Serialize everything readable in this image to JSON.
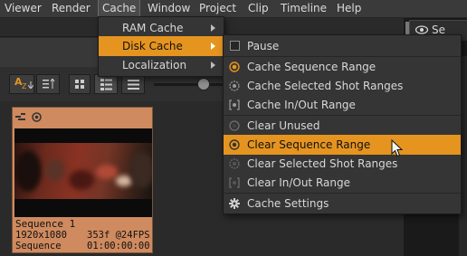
{
  "menubar": {
    "items": [
      "Viewer",
      "Render",
      "Cache",
      "Window",
      "Project",
      "Clip",
      "Timeline",
      "Help"
    ],
    "active": "Cache"
  },
  "right_tab": {
    "label": "Se",
    "icon": "eye-icon"
  },
  "cache_menu": {
    "items": [
      {
        "label": "RAM Cache",
        "submenu": true
      },
      {
        "label": "Disk Cache",
        "submenu": true,
        "highlighted": true
      },
      {
        "label": "Localization",
        "submenu": true
      }
    ]
  },
  "disk_cache_menu": {
    "items": [
      {
        "label": "Pause",
        "icon": "checkbox-icon"
      },
      {
        "label": "Cache Sequence Range",
        "icon": "radio-selected-icon"
      },
      {
        "label": "Cache Selected Shot Ranges",
        "icon": "radio-icon"
      },
      {
        "label": "Cache In/Out Range",
        "icon": "in-out-icon"
      },
      {
        "label": "Clear Unused",
        "icon": "clear-icon"
      },
      {
        "label": "Clear Sequence Range",
        "icon": "clear-sequence-icon",
        "highlighted": true
      },
      {
        "label": "Clear Selected Shot Ranges",
        "icon": "clear-shots-icon"
      },
      {
        "label": "Clear In/Out Range",
        "icon": "clear-in-out-icon"
      },
      {
        "label": "Cache Settings",
        "icon": "gear-icon"
      }
    ]
  },
  "toolbar": {
    "sort_label": "A",
    "sort_sub": "Z",
    "buttons": [
      "sort-az-button",
      "sort-order-button",
      "thumbnail-view-button",
      "detail-view-button",
      "list-view-button"
    ]
  },
  "thumbnail": {
    "name": "Sequence 1",
    "resolution": "1920x1080",
    "frames_fps": "353f @24FPS",
    "type": "Sequence",
    "timecode": "01:00:00:00"
  },
  "colors": {
    "accent": "#e59420",
    "thumb_bg": "#cf8a5f",
    "menu_bg": "#353535"
  }
}
